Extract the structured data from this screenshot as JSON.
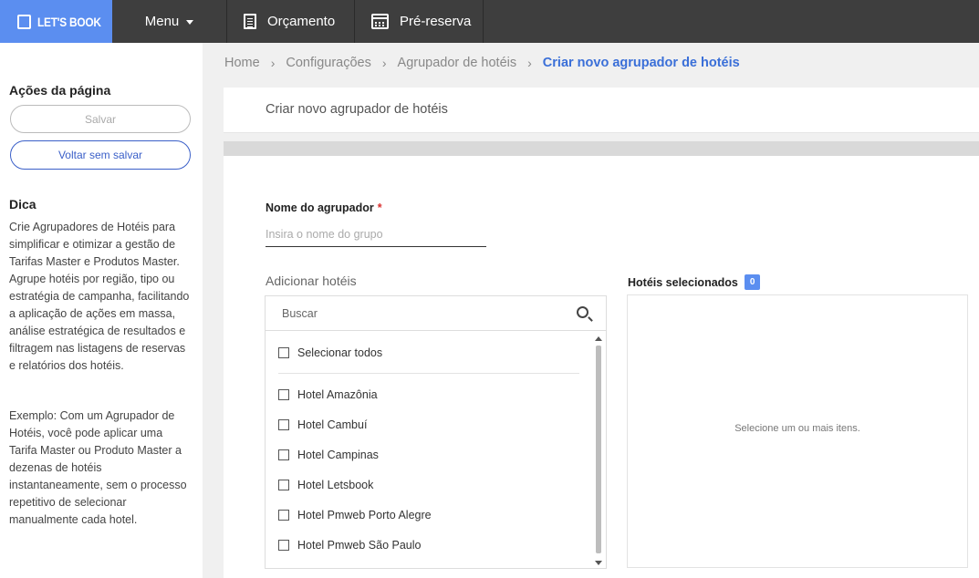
{
  "topbar": {
    "logo_text": "LET'S BOOK",
    "menu_label": "Menu",
    "nav": [
      {
        "label": "Orçamento",
        "icon": "document-icon"
      },
      {
        "label": "Pré-reserva",
        "icon": "calendar-icon"
      }
    ]
  },
  "sidebar": {
    "actions_title": "Ações da página",
    "save_label": "Salvar",
    "back_label": "Voltar sem salvar",
    "tip_title": "Dica",
    "tip_text_1": "Crie Agrupadores de Hotéis para simplificar e otimizar a gestão de Tarifas Master e Produtos Master. Agrupe hotéis por região, tipo ou estratégia de campanha, facilitando a aplicação de ações em massa, análise estratégica de resultados e filtragem nas listagens de reservas e relatórios dos hotéis.",
    "tip_text_2": "Exemplo: Com um Agrupador de Hotéis, você pode aplicar uma Tarifa Master ou Produto Master a dezenas de hotéis instantaneamente, sem o processo repetitivo de selecionar manualmente cada hotel."
  },
  "breadcrumb": [
    "Home",
    "Configurações",
    "Agrupador de hotéis",
    "Criar novo agrupador de hotéis"
  ],
  "header": {
    "title": "Criar novo agrupador de hotéis"
  },
  "form": {
    "name_label": "Nome do agrupador",
    "required_mark": "*",
    "name_placeholder": "Insira o nome do grupo",
    "name_value": "",
    "add_label": "Adicionar hotéis",
    "search_placeholder": "Buscar",
    "select_all_label": "Selecionar todos",
    "hotels": [
      "Hotel Amazônia",
      "Hotel Cambuí",
      "Hotel Campinas",
      "Hotel Letsbook",
      "Hotel Pmweb Porto Alegre",
      "Hotel Pmweb São Paulo"
    ],
    "selected_label": "Hotéis selecionados",
    "selected_count": "0",
    "selected_empty": "Selecione um ou mais itens."
  }
}
